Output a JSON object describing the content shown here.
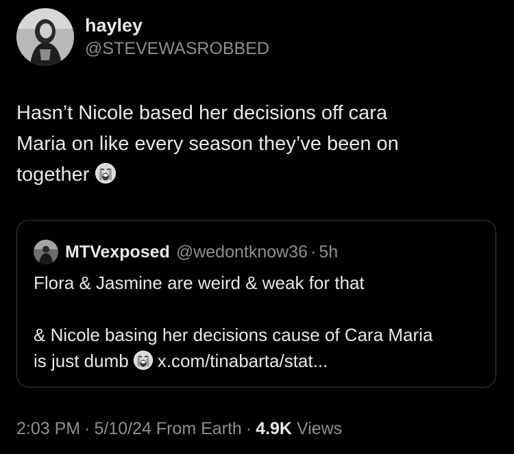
{
  "author": {
    "display_name": "hayley",
    "handle": "@STEVEWASROBBED"
  },
  "tweet": {
    "line1": "Hasn’t Nicole based her decisions off cara",
    "line2": "Maria on like every season they’ve been on",
    "line3": "together",
    "emoji": "loudly-crying-face-emoji"
  },
  "quote": {
    "display_name": "MTVexposed",
    "handle": "@wedontknow36",
    "separator": "·",
    "time": "5h",
    "line1": "Flora & Jasmine are weird & weak for that",
    "line2": "& Nicole basing her decisions cause of Cara Maria",
    "line3_before": "is just dumb",
    "line3_link": "x.com/tinabarta/stat...",
    "emoji": "loudly-crying-face-emoji"
  },
  "meta": {
    "time": "2:03 PM",
    "sep1": "·",
    "date": "5/10/24",
    "source": "From Earth",
    "sep2": "·",
    "views_count": "4.9K",
    "views_label": "Views"
  },
  "colors": {
    "background": "#000000",
    "primary_text": "#e7e9ea",
    "secondary_text": "#8b8f94",
    "border": "#3a3d41"
  }
}
